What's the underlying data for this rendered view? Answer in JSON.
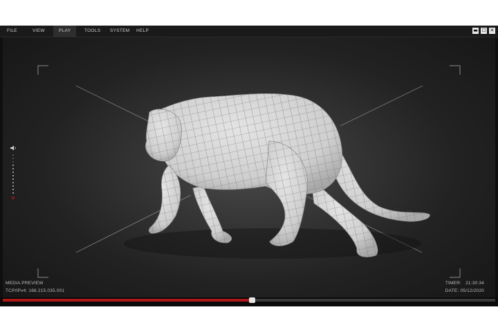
{
  "menu": [
    "FILE",
    "VIEW",
    "PLAY",
    "TOOLS",
    "SYSTEM",
    "HELP"
  ],
  "active_menu": "PLAY",
  "window_controls": {
    "minimize": "▬",
    "maximize": "☐",
    "close": "✕"
  },
  "icons": {
    "volume": "speaker-icon",
    "mute": "mute-x-icon",
    "cursor": "crosshair-icon"
  },
  "viewport_subject": "wireframe panther 3D model",
  "hud": {
    "title": "MEDIA PREVIEW",
    "network": "TCP/IPv4: 168.215.035.001",
    "timer_label": "TIMER:",
    "timer_value": "21:30:34",
    "date_label": "DATE:",
    "date_value": "05/12/2020"
  },
  "playback": {
    "progress_fraction": 0.506
  },
  "volume": {
    "level_steps": 9,
    "total_steps": 12
  },
  "colors": {
    "accent": "#b01818",
    "background": "#0f0f0f"
  }
}
